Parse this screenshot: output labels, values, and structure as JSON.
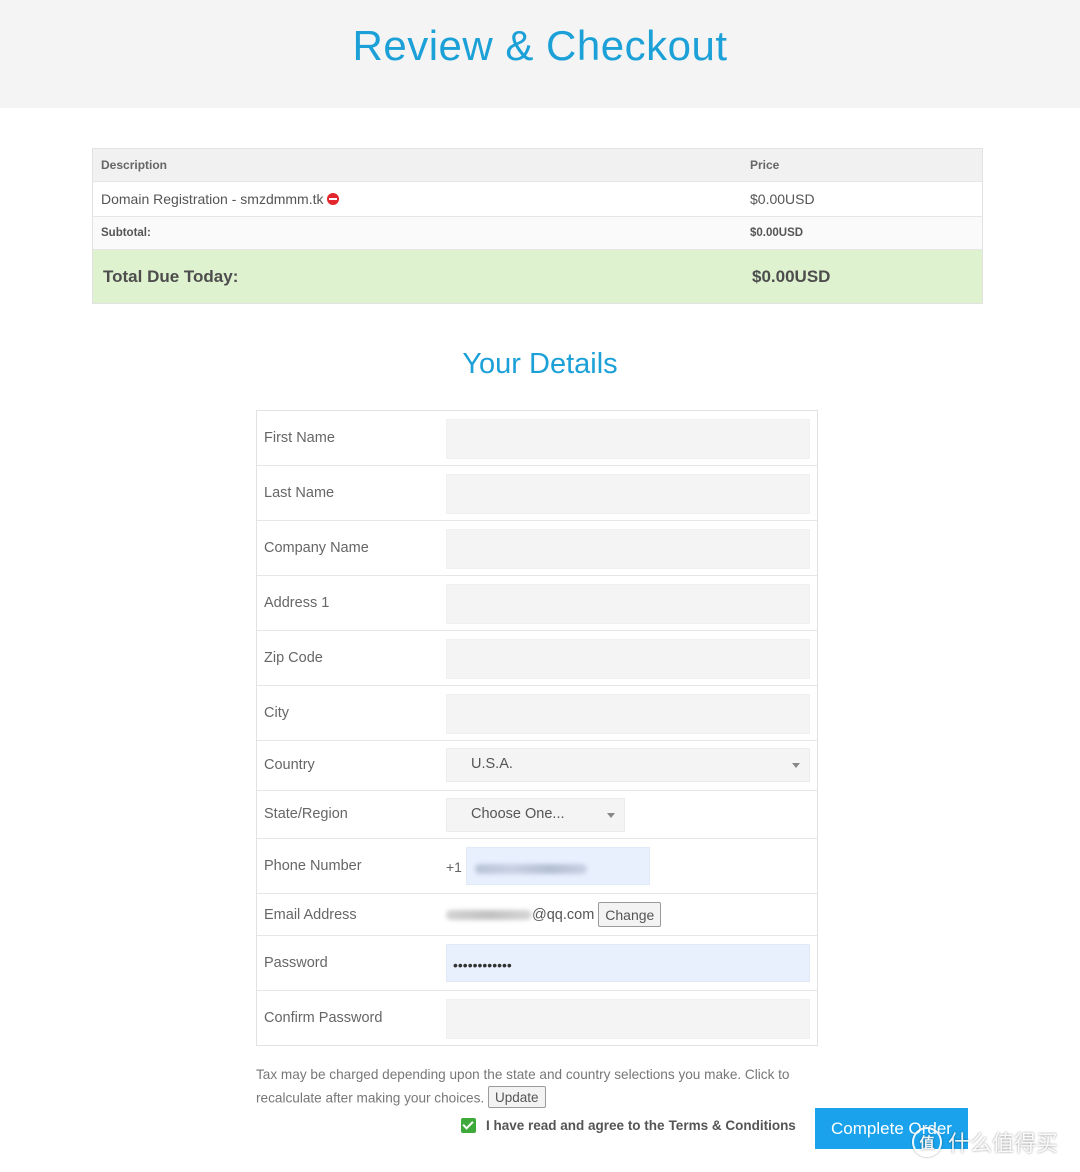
{
  "header": {
    "title": "Review & Checkout"
  },
  "order": {
    "columns": {
      "description": "Description",
      "price": "Price"
    },
    "items": [
      {
        "description": "Domain Registration - smzdmmm.tk",
        "price": "$0.00USD",
        "remove_icon": "remove-circle-icon"
      }
    ],
    "subtotal": {
      "label": "Subtotal:",
      "value": "$0.00USD"
    },
    "total": {
      "label": "Total Due Today:",
      "value": "$0.00USD"
    }
  },
  "details": {
    "title": "Your Details",
    "fields": {
      "first_name": {
        "label": "First Name",
        "value": ""
      },
      "last_name": {
        "label": "Last Name",
        "value": ""
      },
      "company_name": {
        "label": "Company Name",
        "value": ""
      },
      "address1": {
        "label": "Address 1",
        "value": ""
      },
      "zip": {
        "label": "Zip Code",
        "value": ""
      },
      "city": {
        "label": "City",
        "value": ""
      },
      "country": {
        "label": "Country",
        "selected": "U.S.A."
      },
      "state": {
        "label": "State/Region",
        "selected": "Choose One..."
      },
      "phone": {
        "label": "Phone Number",
        "prefix": "+1"
      },
      "email": {
        "label": "Email Address",
        "domain": "@qq.com",
        "change_label": "Change"
      },
      "password": {
        "label": "Password",
        "masked": "••••••••••••"
      },
      "confirm_password": {
        "label": "Confirm Password",
        "value": ""
      }
    }
  },
  "tax_note": {
    "text": "Tax may be charged depending upon the state and country selections you make. Click to recalculate after making your choices.",
    "update_label": "Update"
  },
  "agree": {
    "prefix": "I have read and agree to the",
    "link": "Terms & Conditions",
    "checked": true
  },
  "complete_button": {
    "label": "Complete Order"
  },
  "watermark": {
    "badge": "值",
    "text": "什么值得买"
  },
  "colors": {
    "accent": "#1ba0d7",
    "button": "#1aa3ec",
    "total_bg": "#dff2d0",
    "checkbox": "#3eaa3b",
    "remove": "#e2262c"
  }
}
